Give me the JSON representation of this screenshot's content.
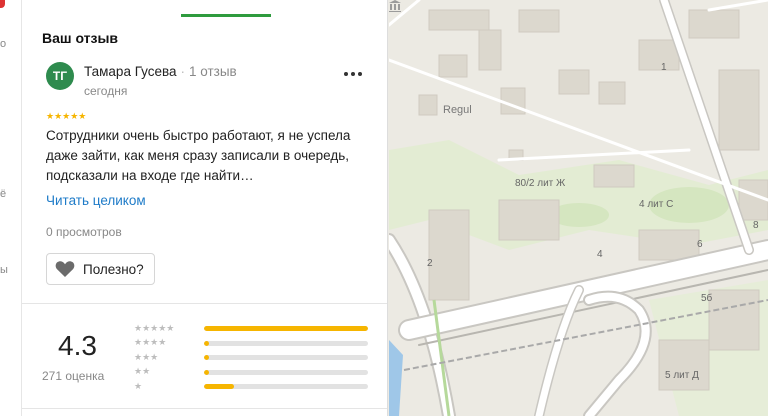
{
  "panel": {
    "section_title": "Ваш отзыв",
    "review": {
      "avatar_initials": "ТГ",
      "author": "Тамара Гусева",
      "separator": "·",
      "review_count": "1 отзыв",
      "date": "сегодня",
      "rating_stars": "★★★★★",
      "text": "Сотрудники очень быстро работают, я не успела даже зайти, как меня сразу записали в очередь, подсказали на входе где найти…",
      "read_more": "Читать целиком",
      "views": "0 просмотров",
      "useful_button": "Полезно?"
    },
    "rating": {
      "score": "4.3",
      "count": "271 оценка",
      "distribution": [
        {
          "stars": "★★★★★",
          "fraction": 1.0
        },
        {
          "stars": "★★★★",
          "fraction": 0.02
        },
        {
          "stars": "★★★",
          "fraction": 0.02
        },
        {
          "stars": "★★",
          "fraction": 0.02
        },
        {
          "stars": "★",
          "fraction": 0.18
        }
      ]
    }
  },
  "rail": {
    "fragments": [
      "o",
      "ё",
      "ы"
    ]
  },
  "map": {
    "poi": "Regul",
    "labels": [
      "1",
      "80/2 лит Ж",
      "4 лит С",
      "2",
      "4",
      "5б",
      "5 лит Д",
      "6",
      "8"
    ]
  },
  "colors": {
    "accent": "#2e9b3e",
    "star": "#f6b500",
    "link": "#1e7bc8",
    "avatar": "#2e8b4e"
  }
}
